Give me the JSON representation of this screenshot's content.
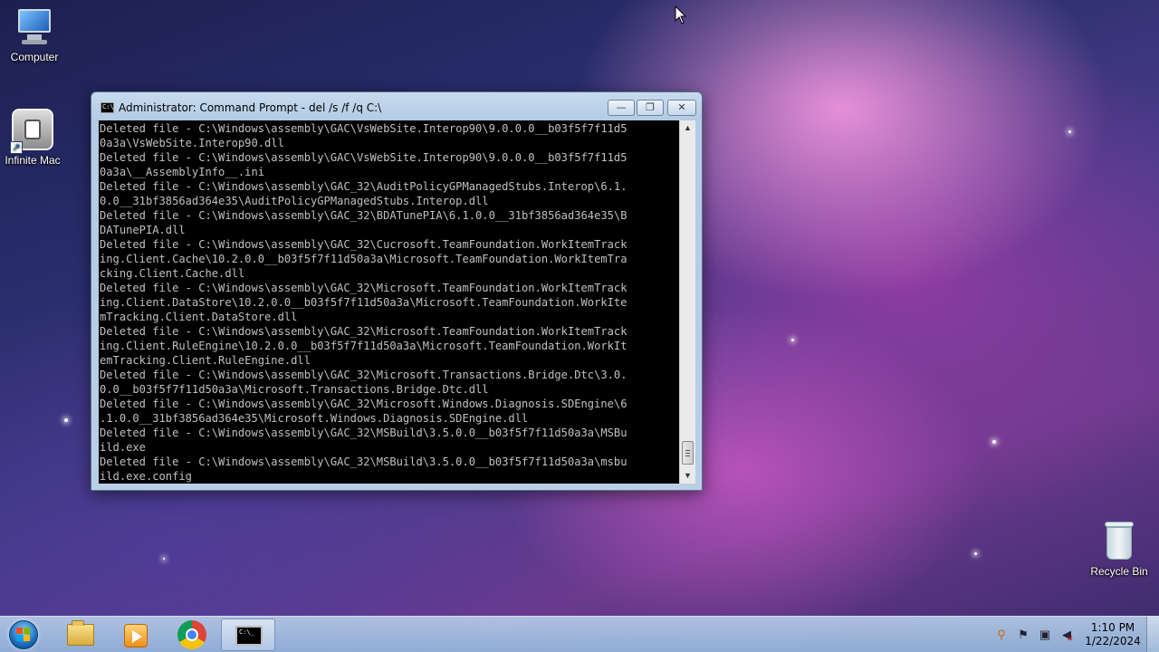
{
  "desktop": {
    "icons": [
      {
        "label": "Computer"
      },
      {
        "label": "Infinite Mac"
      },
      {
        "label": "Recycle Bin"
      }
    ]
  },
  "window": {
    "title": "Administrator:  Command Prompt - del  /s /f /q C:\\",
    "controls": {
      "minimize": "—",
      "maximize": "❐",
      "close": "✕"
    },
    "console_lines": [
      "Deleted file - C:\\Windows\\assembly\\GAC\\VsWebSite.Interop90\\9.0.0.0__b03f5f7f11d5",
      "0a3a\\VsWebSite.Interop90.dll",
      "Deleted file - C:\\Windows\\assembly\\GAC\\VsWebSite.Interop90\\9.0.0.0__b03f5f7f11d5",
      "0a3a\\__AssemblyInfo__.ini",
      "Deleted file - C:\\Windows\\assembly\\GAC_32\\AuditPolicyGPManagedStubs.Interop\\6.1.",
      "0.0__31bf3856ad364e35\\AuditPolicyGPManagedStubs.Interop.dll",
      "Deleted file - C:\\Windows\\assembly\\GAC_32\\BDATunePIA\\6.1.0.0__31bf3856ad364e35\\B",
      "DATunePIA.dll",
      "Deleted file - C:\\Windows\\assembly\\GAC_32\\Cucrosoft.TeamFoundation.WorkItemTrack",
      "ing.Client.Cache\\10.2.0.0__b03f5f7f11d50a3a\\Microsoft.TeamFoundation.WorkItemTra",
      "cking.Client.Cache.dll",
      "Deleted file - C:\\Windows\\assembly\\GAC_32\\Microsoft.TeamFoundation.WorkItemTrack",
      "ing.Client.DataStore\\10.2.0.0__b03f5f7f11d50a3a\\Microsoft.TeamFoundation.WorkIte",
      "mTracking.Client.DataStore.dll",
      "Deleted file - C:\\Windows\\assembly\\GAC_32\\Microsoft.TeamFoundation.WorkItemTrack",
      "ing.Client.RuleEngine\\10.2.0.0__b03f5f7f11d50a3a\\Microsoft.TeamFoundation.WorkIt",
      "emTracking.Client.RuleEngine.dll",
      "Deleted file - C:\\Windows\\assembly\\GAC_32\\Microsoft.Transactions.Bridge.Dtc\\3.0.",
      "0.0__b03f5f7f11d50a3a\\Microsoft.Transactions.Bridge.Dtc.dll",
      "Deleted file - C:\\Windows\\assembly\\GAC_32\\Microsoft.Windows.Diagnosis.SDEngine\\6",
      ".1.0.0__31bf3856ad364e35\\Microsoft.Windows.Diagnosis.SDEngine.dll",
      "Deleted file - C:\\Windows\\assembly\\GAC_32\\MSBuild\\3.5.0.0__b03f5f7f11d50a3a\\MSBu",
      "ild.exe",
      "Deleted file - C:\\Windows\\assembly\\GAC_32\\MSBuild\\3.5.0.0__b03f5f7f11d50a3a\\msbu",
      "ild.exe.config"
    ]
  },
  "taskbar": {
    "items": [
      "start-orb",
      "windows-explorer",
      "media-player",
      "google-chrome",
      "command-prompt"
    ],
    "clock": {
      "time": "1:10 PM",
      "date": "1/22/2024"
    },
    "tray_icons": [
      "search-icon",
      "flag-icon",
      "network-icon",
      "volume-muted-icon"
    ]
  },
  "colors": {
    "console_bg": "#000000",
    "console_text": "#c0c0c0"
  }
}
